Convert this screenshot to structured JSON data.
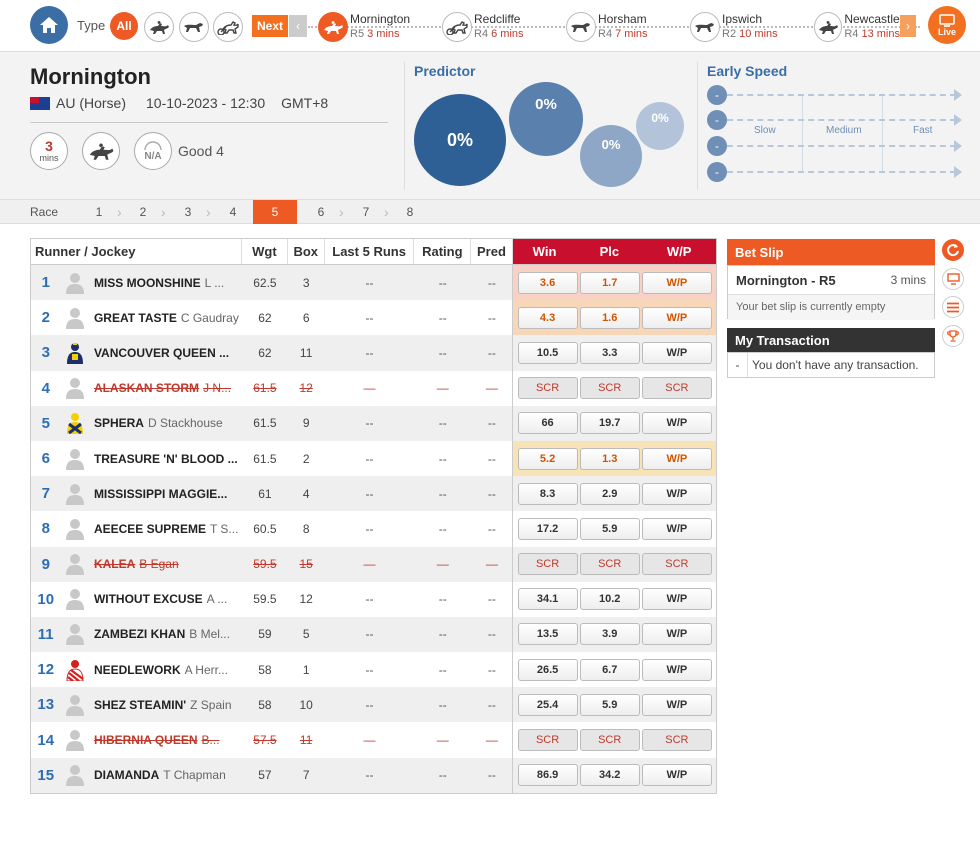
{
  "topnav": {
    "type_label": "Type",
    "all_label": "All",
    "next_label": "Next",
    "live_label": "Live",
    "races": [
      {
        "name": "Mornington",
        "code": "R5",
        "mins": "3 mins",
        "active": true
      },
      {
        "name": "Redcliffe",
        "code": "R4",
        "mins": "6 mins",
        "active": false
      },
      {
        "name": "Horsham",
        "code": "R4",
        "mins": "7 mins",
        "active": false
      },
      {
        "name": "Ipswich",
        "code": "R2",
        "mins": "10 mins",
        "active": false
      },
      {
        "name": "Newcastle",
        "code": "R4",
        "mins": "13 mins",
        "active": false
      }
    ]
  },
  "header": {
    "title": "Mornington",
    "country": "AU (Horse)",
    "datetime": "10-10-2023 - 12:30",
    "timezone": "GMT+8",
    "mins_num": "3",
    "mins_label": "mins",
    "na_label": "N/A",
    "track_condition": "Good 4"
  },
  "predictor": {
    "title": "Predictor",
    "bubbles": [
      "0%",
      "0%",
      "0%",
      "0%"
    ]
  },
  "early_speed": {
    "title": "Early Speed",
    "dot_label": "-",
    "labels": [
      "Slow",
      "Medium",
      "Fast"
    ]
  },
  "race_tabs": {
    "label": "Race",
    "tabs": [
      "1",
      "2",
      "3",
      "4",
      "5",
      "6",
      "7",
      "8"
    ],
    "active": "5"
  },
  "table": {
    "headers": {
      "runner": "Runner / Jockey",
      "wgt": "Wgt",
      "box": "Box",
      "last5": "Last 5 Runs",
      "rating": "Rating",
      "pred": "Pred",
      "win": "Win",
      "plc": "Plc",
      "wp": "W/P"
    },
    "rows": [
      {
        "num": "1",
        "horse": "MISS MOONSHINE",
        "jockey": "L ...",
        "wgt": "62.5",
        "box": "3",
        "last5": "--",
        "rating": "--",
        "pred": "--",
        "win": "3.6",
        "plc": "1.7",
        "wp": "W/P",
        "status": "fav",
        "silk": "default"
      },
      {
        "num": "2",
        "horse": "GREAT TASTE",
        "jockey": "C Gaudray",
        "wgt": "62",
        "box": "6",
        "last5": "--",
        "rating": "--",
        "pred": "--",
        "win": "4.3",
        "plc": "1.6",
        "wp": "W/P",
        "status": "fav2",
        "silk": "default"
      },
      {
        "num": "3",
        "horse": "VANCOUVER QUEEN ...",
        "jockey": "",
        "wgt": "62",
        "box": "11",
        "last5": "--",
        "rating": "--",
        "pred": "--",
        "win": "10.5",
        "plc": "3.3",
        "wp": "W/P",
        "status": "",
        "silk": "navy-yellow"
      },
      {
        "num": "4",
        "horse": "ALASKAN STORM",
        "jockey": "J N...",
        "wgt": "61.5",
        "box": "12",
        "last5": "—",
        "rating": "—",
        "pred": "—",
        "win": "SCR",
        "plc": "SCR",
        "wp": "SCR",
        "status": "scr",
        "silk": "default"
      },
      {
        "num": "5",
        "horse": "SPHERA",
        "jockey": "D Stackhouse",
        "wgt": "61.5",
        "box": "9",
        "last5": "--",
        "rating": "--",
        "pred": "--",
        "win": "66",
        "plc": "19.7",
        "wp": "W/P",
        "status": "",
        "silk": "yellow-navy"
      },
      {
        "num": "6",
        "horse": "TREASURE 'N' BLOOD ...",
        "jockey": "",
        "wgt": "61.5",
        "box": "2",
        "last5": "--",
        "rating": "--",
        "pred": "--",
        "win": "5.2",
        "plc": "1.3",
        "wp": "W/P",
        "status": "fav3",
        "silk": "default"
      },
      {
        "num": "7",
        "horse": "MISSISSIPPI MAGGIE...",
        "jockey": "",
        "wgt": "61",
        "box": "4",
        "last5": "--",
        "rating": "--",
        "pred": "--",
        "win": "8.3",
        "plc": "2.9",
        "wp": "W/P",
        "status": "",
        "silk": "default"
      },
      {
        "num": "8",
        "horse": "AEECEE SUPREME",
        "jockey": "T S...",
        "wgt": "60.5",
        "box": "8",
        "last5": "--",
        "rating": "--",
        "pred": "--",
        "win": "17.2",
        "plc": "5.9",
        "wp": "W/P",
        "status": "",
        "silk": "default"
      },
      {
        "num": "9",
        "horse": "KALEA",
        "jockey": "B Egan",
        "wgt": "59.5",
        "box": "15",
        "last5": "—",
        "rating": "—",
        "pred": "—",
        "win": "SCR",
        "plc": "SCR",
        "wp": "SCR",
        "status": "scr",
        "silk": "default"
      },
      {
        "num": "10",
        "horse": "WITHOUT EXCUSE",
        "jockey": "A ...",
        "wgt": "59.5",
        "box": "12",
        "last5": "--",
        "rating": "--",
        "pred": "--",
        "win": "34.1",
        "plc": "10.2",
        "wp": "W/P",
        "status": "",
        "silk": "default"
      },
      {
        "num": "11",
        "horse": "ZAMBEZI KHAN",
        "jockey": "B Mel...",
        "wgt": "59",
        "box": "5",
        "last5": "--",
        "rating": "--",
        "pred": "--",
        "win": "13.5",
        "plc": "3.9",
        "wp": "W/P",
        "status": "",
        "silk": "default"
      },
      {
        "num": "12",
        "horse": "NEEDLEWORK",
        "jockey": "A Herr...",
        "wgt": "58",
        "box": "1",
        "last5": "--",
        "rating": "--",
        "pred": "--",
        "win": "26.5",
        "plc": "6.7",
        "wp": "W/P",
        "status": "",
        "silk": "red-stripe"
      },
      {
        "num": "13",
        "horse": "SHEZ STEAMIN'",
        "jockey": "Z Spain",
        "wgt": "58",
        "box": "10",
        "last5": "--",
        "rating": "--",
        "pred": "--",
        "win": "25.4",
        "plc": "5.9",
        "wp": "W/P",
        "status": "",
        "silk": "default"
      },
      {
        "num": "14",
        "horse": "HIBERNIA QUEEN",
        "jockey": "B...",
        "wgt": "57.5",
        "box": "11",
        "last5": "—",
        "rating": "—",
        "pred": "—",
        "win": "SCR",
        "plc": "SCR",
        "wp": "SCR",
        "status": "scr",
        "silk": "default"
      },
      {
        "num": "15",
        "horse": "DIAMANDA",
        "jockey": "T Chapman",
        "wgt": "57",
        "box": "7",
        "last5": "--",
        "rating": "--",
        "pred": "--",
        "win": "86.9",
        "plc": "34.2",
        "wp": "W/P",
        "status": "",
        "silk": "default"
      }
    ]
  },
  "betslip": {
    "title": "Bet Slip",
    "race": "Mornington - R5",
    "mins": "3 mins",
    "empty_msg": "Your bet slip is currently empty"
  },
  "transaction": {
    "title": "My Transaction",
    "dash": "-",
    "empty_msg": "You don't have any transaction."
  },
  "colors": {
    "accent_orange": "#ee5a24",
    "primary_blue": "#3a6ea5",
    "odds_header_red": "#c8102e"
  }
}
